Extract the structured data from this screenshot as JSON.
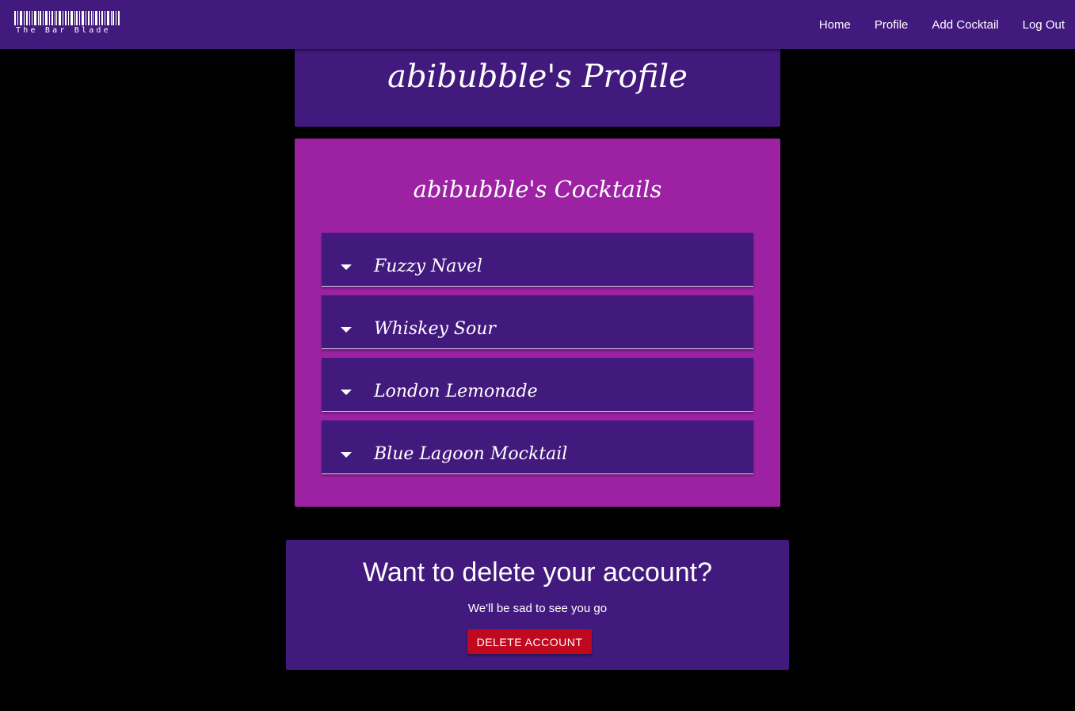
{
  "navbar": {
    "logo_text": "The Bar Blade",
    "links": [
      "Home",
      "Profile",
      "Add Cocktail",
      "Log Out"
    ]
  },
  "profile": {
    "title": "abibubble's Profile"
  },
  "cocktails": {
    "title": "abibubble's Cocktails",
    "items": [
      "Fuzzy Navel",
      "Whiskey Sour",
      "London Lemonade",
      "Blue Lagoon Mocktail"
    ]
  },
  "delete_section": {
    "title": "Want to delete your account?",
    "subtitle": "We'll be sad to see you go",
    "button_label": "Delete Account"
  },
  "colors": {
    "navbar_bg": "#421a7e",
    "card_bg": "#9c22a3",
    "item_bg": "#421a7e",
    "danger": "#c0081f",
    "page_bg": "#000000"
  },
  "icons": {
    "logo": "barcode-icon",
    "expand": "caret-down-icon"
  }
}
